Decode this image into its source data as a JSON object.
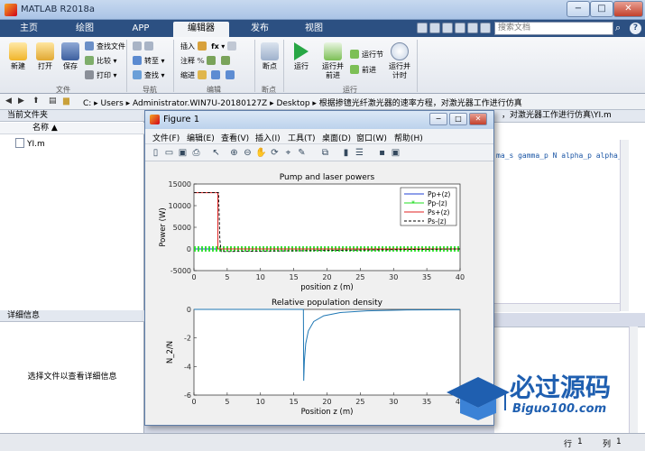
{
  "app_title": "MATLAB R2018a",
  "window_controls": {
    "minimize": "−",
    "maximize": "□",
    "close": "✕"
  },
  "tabs": [
    "主页",
    "绘图",
    "APP",
    "编辑器",
    "发布",
    "视图"
  ],
  "active_tab": "编辑器",
  "search": {
    "placeholder": "搜索文档"
  },
  "ribbon": {
    "file": {
      "new": "新建",
      "open": "打开",
      "save": "保存",
      "find_files": "查找文件",
      "compare": "比较",
      "print": "打印",
      "group": "文件"
    },
    "navigate": {
      "goto": "转至",
      "find": "查找",
      "group": "导航"
    },
    "edit": {
      "insert": "插入",
      "comment": "注释",
      "indent": "缩进",
      "fx": "fx",
      "group": "编辑"
    },
    "breakpoints": {
      "label": "断点",
      "group": "断点"
    },
    "run": {
      "run": "运行",
      "run_advance_1": "运行并",
      "run_advance_2": "前进",
      "run_section": "运行节",
      "advance": "前进",
      "run_time_1": "运行并",
      "run_time_2": "计时",
      "group": "运行"
    }
  },
  "address": {
    "path": "C: ▸ Users ▸ Administrator.WIN7U-20180127Z ▸ Desktop ▸ 根据掺镱光纤激光器的速率方程，对激光器工作进行仿真",
    "nav_icons": [
      "back-icon",
      "forward-icon",
      "up-icon",
      "browse-icon",
      "folder-icon"
    ]
  },
  "current_folder": {
    "title": "当前文件夹",
    "column": "名称 ▲",
    "files": [
      "YI.m"
    ]
  },
  "details": {
    "title": "详细信息",
    "message": "选择文件以查看详细信息"
  },
  "editor": {
    "tab_label": "，对激光器工作进行仿真\\YI.m",
    "code_line": "ma_s gamma_p N alpha_p alpha_"
  },
  "statusbar": {
    "row_label": "行",
    "row_value": "1",
    "col_label": "列",
    "col_value": "1"
  },
  "figure": {
    "title": "Figure 1",
    "menu": [
      "文件(F)",
      "编辑(E)",
      "查看(V)",
      "插入(I)",
      "工具(T)",
      "桌面(D)",
      "窗口(W)",
      "帮助(H)"
    ]
  },
  "watermark": {
    "text": "必过源码",
    "sub": "Biguo100.com"
  },
  "chart_data": [
    {
      "type": "line",
      "title": "Pump and laser powers",
      "xlabel": "position z (m)",
      "ylabel": "Power (W)",
      "xlim": [
        0,
        40
      ],
      "ylim": [
        -5000,
        15000
      ],
      "xticks": [
        0,
        5,
        10,
        15,
        20,
        25,
        30,
        35,
        40
      ],
      "yticks": [
        -5000,
        0,
        5000,
        10000,
        15000
      ],
      "legend": "top-right",
      "series": [
        {
          "name": "Pp+(z)",
          "color": "#1f3fd6",
          "style": "solid",
          "x": [
            0,
            40
          ],
          "y": [
            0,
            0
          ]
        },
        {
          "name": "Pp-(z)",
          "color": "#22dd22",
          "style": "marker",
          "x": [
            0,
            40
          ],
          "y": [
            0,
            0
          ]
        },
        {
          "name": "Ps+(z)",
          "color": "#e02020",
          "style": "solid",
          "x": [
            0,
            3.6,
            3.6,
            4.1,
            40
          ],
          "y": [
            13000,
            13000,
            0,
            0,
            0
          ]
        },
        {
          "name": "Ps-(z)",
          "color": "#000000",
          "style": "dashed",
          "x": [
            0,
            3.7,
            3.9,
            4.1,
            40
          ],
          "y": [
            13000,
            13000,
            2000,
            -600,
            0
          ]
        }
      ]
    },
    {
      "type": "line",
      "title": "Relative population density",
      "xlabel": "Position z (m)",
      "ylabel": "N_2/N",
      "xlim": [
        0,
        40
      ],
      "ylim": [
        -6,
        0
      ],
      "xticks": [
        0,
        5,
        10,
        15,
        20,
        25,
        30,
        35,
        40
      ],
      "yticks": [
        -6,
        -4,
        -2,
        0
      ],
      "series": [
        {
          "color": "#1f77b4",
          "style": "solid",
          "x": [
            0,
            16,
            16.45,
            16.5,
            16.6,
            16.8,
            17.2,
            18,
            19.5,
            22,
            26,
            32,
            40
          ],
          "y": [
            0,
            0,
            0,
            -5.0,
            -3.6,
            -2.4,
            -1.5,
            -0.85,
            -0.45,
            -0.22,
            -0.1,
            -0.04,
            -0.02
          ]
        }
      ]
    }
  ]
}
